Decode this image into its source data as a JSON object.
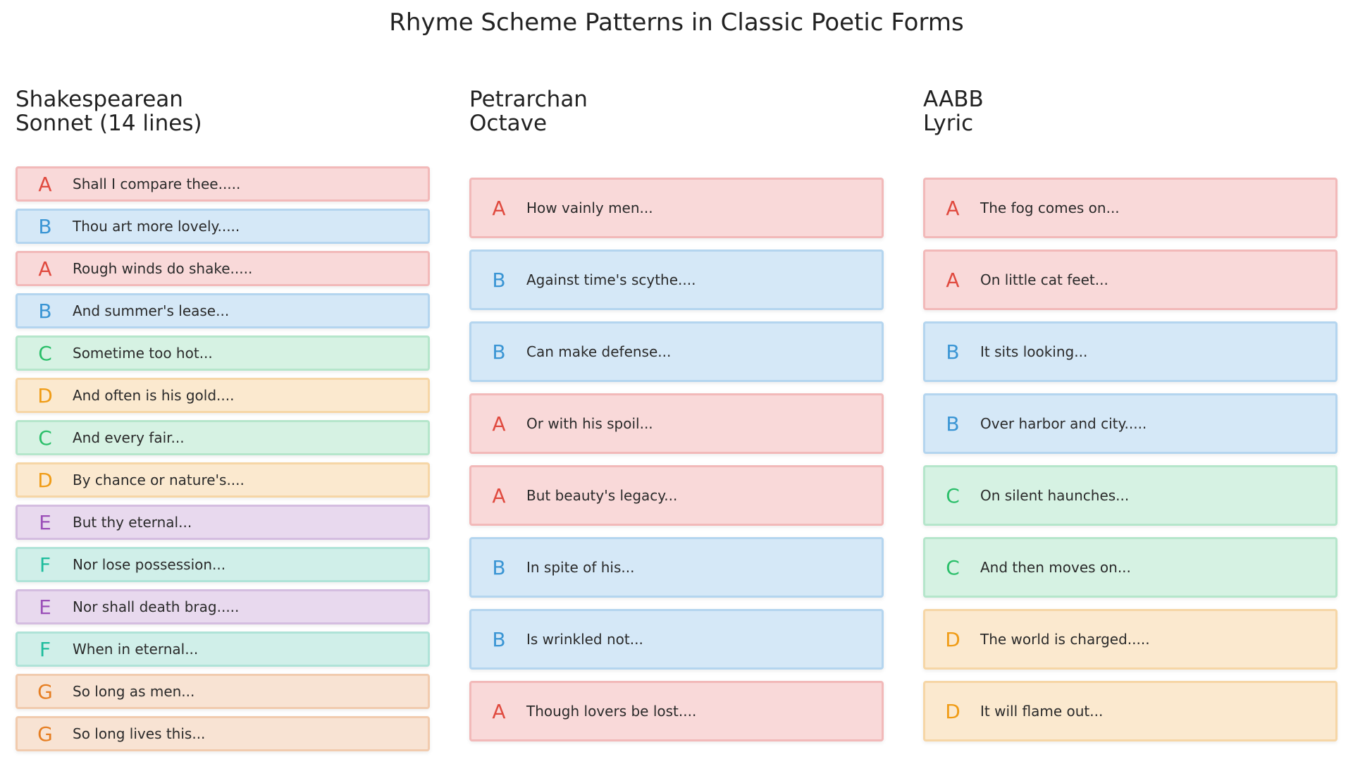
{
  "title": "Rhyme Scheme Patterns in Classic Poetic Forms",
  "columns": [
    {
      "header_line1": "Shakespearean",
      "header_line2": "Sonnet (14 lines)",
      "lines": [
        {
          "rhyme": "A",
          "text": "Shall I compare thee....."
        },
        {
          "rhyme": "B",
          "text": "Thou art more lovely....."
        },
        {
          "rhyme": "A",
          "text": "Rough winds do shake....."
        },
        {
          "rhyme": "B",
          "text": "And summer's lease..."
        },
        {
          "rhyme": "C",
          "text": "Sometime too hot..."
        },
        {
          "rhyme": "D",
          "text": "And often is his gold...."
        },
        {
          "rhyme": "C",
          "text": "And every fair..."
        },
        {
          "rhyme": "D",
          "text": "By chance or nature's...."
        },
        {
          "rhyme": "E",
          "text": "But thy eternal..."
        },
        {
          "rhyme": "F",
          "text": "Nor lose possession..."
        },
        {
          "rhyme": "E",
          "text": "Nor shall death brag....."
        },
        {
          "rhyme": "F",
          "text": "When in eternal..."
        },
        {
          "rhyme": "G",
          "text": "So long as men..."
        },
        {
          "rhyme": "G",
          "text": "So long lives this..."
        }
      ]
    },
    {
      "header_line1": "Petrarchan",
      "header_line2": "Octave",
      "lines": [
        {
          "rhyme": "A",
          "text": "How vainly men..."
        },
        {
          "rhyme": "B",
          "text": "Against time's scythe...."
        },
        {
          "rhyme": "B",
          "text": "Can make defense..."
        },
        {
          "rhyme": "A",
          "text": "Or with his spoil..."
        },
        {
          "rhyme": "A",
          "text": "But beauty's legacy..."
        },
        {
          "rhyme": "B",
          "text": "In spite of his..."
        },
        {
          "rhyme": "B",
          "text": "Is wrinkled not..."
        },
        {
          "rhyme": "A",
          "text": "Though lovers be lost...."
        }
      ]
    },
    {
      "header_line1": "AABB",
      "header_line2": "Lyric",
      "lines": [
        {
          "rhyme": "A",
          "text": "The fog comes on..."
        },
        {
          "rhyme": "A",
          "text": "On little cat feet..."
        },
        {
          "rhyme": "B",
          "text": "It sits looking..."
        },
        {
          "rhyme": "B",
          "text": "Over harbor and city....."
        },
        {
          "rhyme": "C",
          "text": "On silent haunches..."
        },
        {
          "rhyme": "C",
          "text": "And then moves on..."
        },
        {
          "rhyme": "D",
          "text": "The world is charged....."
        },
        {
          "rhyme": "D",
          "text": "It will flame out..."
        }
      ]
    }
  ]
}
